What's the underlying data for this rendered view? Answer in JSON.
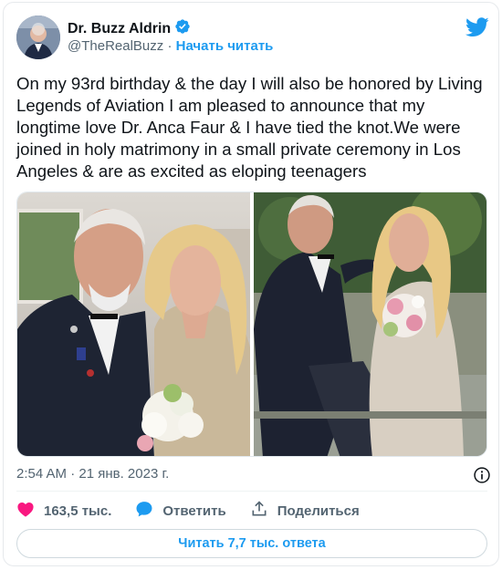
{
  "colors": {
    "accent": "#1d9bf0",
    "like": "#f91880",
    "text": "#0f1419",
    "muted": "#536471"
  },
  "author": {
    "name": "Dr. Buzz Aldrin",
    "handle": "@TheRealBuzz",
    "separator": "·",
    "follow_label": "Начать читать",
    "verified_icon": "verified-badge-icon"
  },
  "tweet": {
    "text": "On my 93rd birthday & the day I will also be honored by Living Legends of Aviation I am pleased to announce that my longtime love Dr. Anca Faur & I have tied the knot.We were joined in holy matrimony in a small private ceremony in Los Angeles & are as excited as eloping teenagers",
    "timestamp": "2:54 AM · 21 янв. 2023 г."
  },
  "actions": {
    "likes": "163,5 тыс.",
    "reply_label": "Ответить",
    "share_label": "Поделиться"
  },
  "read_replies_label": "Читать 7,7 тыс. ответа",
  "icons": [
    "twitter-bird-icon",
    "info-icon",
    "heart-icon",
    "reply-icon",
    "share-icon"
  ]
}
